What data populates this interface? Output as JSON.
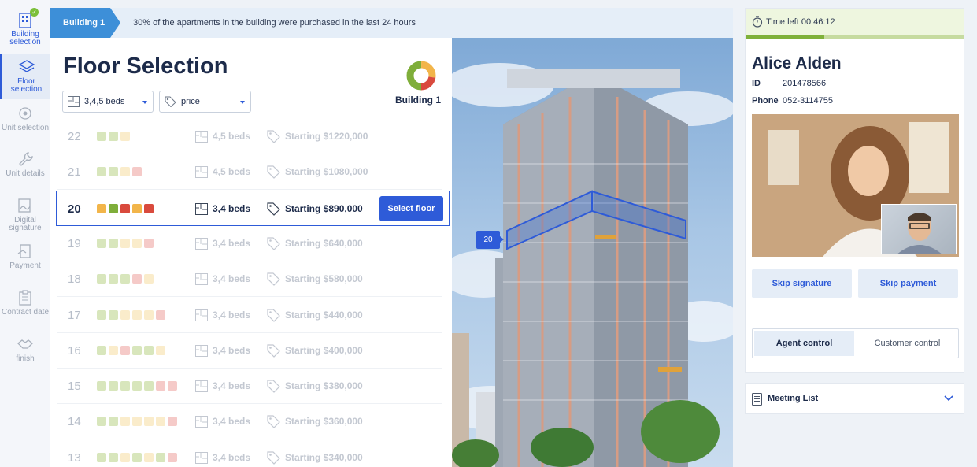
{
  "nav": {
    "items": [
      {
        "label": "Building selection",
        "icon": "building-icon",
        "state": "done"
      },
      {
        "label": "Floor selection",
        "icon": "layers-icon",
        "state": "active"
      },
      {
        "label": "Unit selection",
        "icon": "unit-target-icon",
        "state": "pending"
      },
      {
        "label": "Unit details",
        "icon": "wrench-icon",
        "state": "pending"
      },
      {
        "label": "Digital signature",
        "icon": "signature-icon",
        "state": "pending"
      },
      {
        "label": "Payment",
        "icon": "payment-icon",
        "state": "pending"
      },
      {
        "label": "Contract date",
        "icon": "clipboard-icon",
        "state": "pending"
      },
      {
        "label": "finish",
        "icon": "handshake-icon",
        "state": "pending"
      }
    ]
  },
  "banner": {
    "chip": "Building 1",
    "text": "30% of the apartments in the building were purchased in the last 24 hours"
  },
  "floor_panel": {
    "title": "Floor Selection",
    "beds_filter": "3,4,5 beds",
    "price_filter": "price",
    "building_label": "Building 1",
    "select_label": "Select floor",
    "colors": {
      "green": "#7fae3a",
      "lightgreen": "#a9c86a",
      "yellow": "#f2b54a",
      "lightyellow": "#f5d58c",
      "red": "#d94a3d",
      "pink": "#e88a86"
    },
    "floors": [
      {
        "floor": "22",
        "beds": "4,5 beds",
        "price": "Starting $1220,000",
        "dots": [
          "lightgreen",
          "lightgreen",
          "lightyellow"
        ]
      },
      {
        "floor": "21",
        "beds": "4,5 beds",
        "price": "Starting $1080,000",
        "dots": [
          "lightgreen",
          "lightgreen",
          "lightyellow",
          "pink"
        ]
      },
      {
        "floor": "20",
        "beds": "3,4 beds",
        "price": "Starting $890,000",
        "dots": [
          "yellow",
          "green",
          "red",
          "yellow",
          "red"
        ],
        "active": true
      },
      {
        "floor": "19",
        "beds": "3,4 beds",
        "price": "Starting $640,000",
        "dots": [
          "lightgreen",
          "lightgreen",
          "lightyellow",
          "lightyellow",
          "pink"
        ]
      },
      {
        "floor": "18",
        "beds": "3,4 beds",
        "price": "Starting $580,000",
        "dots": [
          "lightgreen",
          "lightgreen",
          "lightgreen",
          "pink",
          "lightyellow"
        ]
      },
      {
        "floor": "17",
        "beds": "3,4 beds",
        "price": "Starting $440,000",
        "dots": [
          "lightgreen",
          "lightgreen",
          "lightyellow",
          "lightyellow",
          "lightyellow",
          "pink"
        ]
      },
      {
        "floor": "16",
        "beds": "3,4 beds",
        "price": "Starting $400,000",
        "dots": [
          "lightgreen",
          "lightyellow",
          "pink",
          "lightgreen",
          "lightgreen",
          "lightyellow"
        ]
      },
      {
        "floor": "15",
        "beds": "3,4 beds",
        "price": "Starting $380,000",
        "dots": [
          "lightgreen",
          "lightgreen",
          "lightgreen",
          "lightgreen",
          "lightgreen",
          "pink",
          "pink"
        ]
      },
      {
        "floor": "14",
        "beds": "3,4 beds",
        "price": "Starting $360,000",
        "dots": [
          "lightgreen",
          "lightgreen",
          "lightyellow",
          "lightyellow",
          "lightyellow",
          "lightyellow",
          "pink"
        ]
      },
      {
        "floor": "13",
        "beds": "3,4 beds",
        "price": "Starting $340,000",
        "dots": [
          "lightgreen",
          "lightgreen",
          "lightyellow",
          "lightgreen",
          "lightyellow",
          "lightgreen",
          "pink"
        ]
      }
    ]
  },
  "building_view": {
    "marker": "20"
  },
  "customer": {
    "timer_text": "Time left 00:46:12",
    "progress": 0.36,
    "name": "Alice Alden",
    "id_label": "ID",
    "id_value": "201478566",
    "phone_label": "Phone",
    "phone_value": "052-3114755",
    "skip_signature": "Skip signature",
    "skip_payment": "Skip payment",
    "agent_control": "Agent control",
    "customer_control": "Customer control"
  },
  "meeting": {
    "label": "Meeting List"
  }
}
